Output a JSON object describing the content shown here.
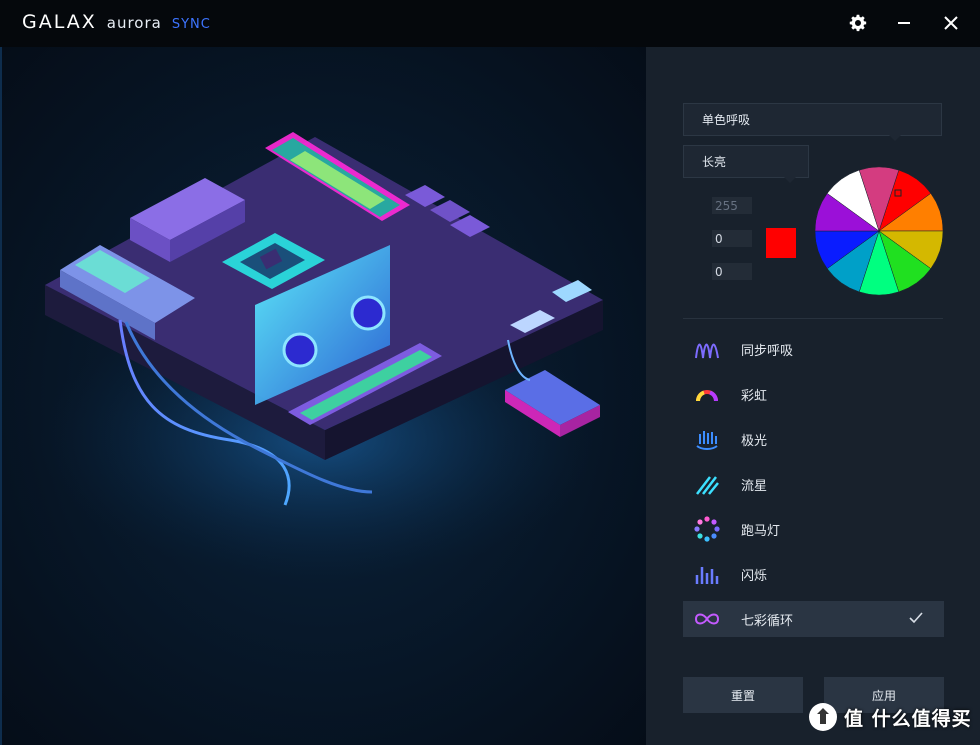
{
  "title": {
    "brand": "GALAX",
    "product": "aurora",
    "product_sub": "SYNC",
    "icons": {
      "settings": "gear-icon",
      "minimize": "minimize-icon",
      "close": "close-icon"
    }
  },
  "panel": {
    "mode_dropdown": "单色呼吸",
    "light_dropdown": "长亮",
    "rgb_values": [
      "255",
      "0",
      "0"
    ],
    "selected_color": "#ff0000",
    "wheel_colors": [
      "#ff0000",
      "#ff7f00",
      "#d4b800",
      "#20e020",
      "#00ff80",
      "#00a0c8",
      "#0a1cff",
      "#9b10d8",
      "#ffffff",
      "#d43c80"
    ],
    "effects": [
      {
        "label": "同步呼吸",
        "icon": "wave-icon"
      },
      {
        "label": "彩虹",
        "icon": "rainbow-icon"
      },
      {
        "label": "极光",
        "icon": "aurora-icon"
      },
      {
        "label": "流星",
        "icon": "meteor-icon"
      },
      {
        "label": "跑马灯",
        "icon": "marquee-icon"
      },
      {
        "label": "闪烁",
        "icon": "flash-icon"
      },
      {
        "label": "七彩循环",
        "icon": "infinity-icon",
        "selected": true
      }
    ],
    "reset_label": "重置",
    "apply_label": "应用"
  },
  "watermark": {
    "text": "值 什么值得买",
    "icon": "smzdm-logo-icon"
  }
}
